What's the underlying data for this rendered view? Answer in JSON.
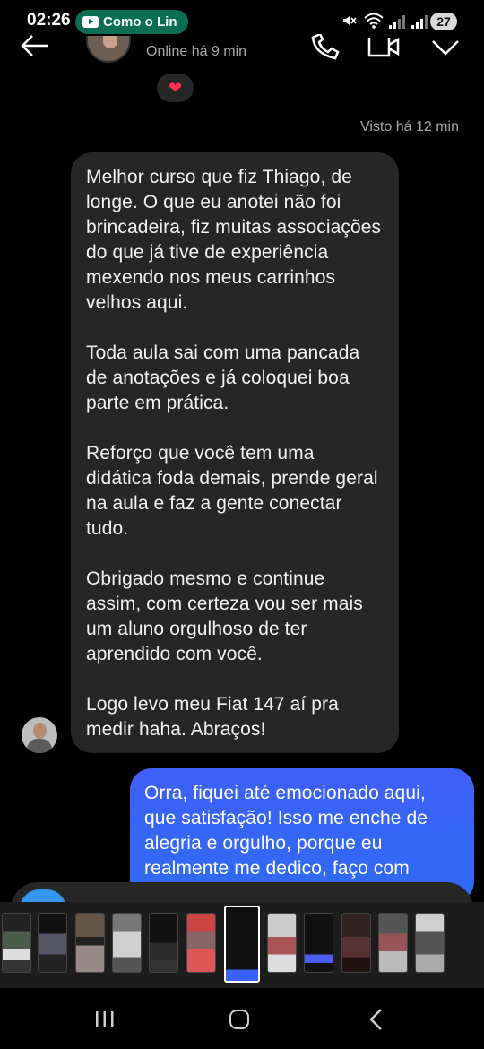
{
  "status_bar": {
    "time": "02:26",
    "notification_text": "Como o Lin",
    "battery": "27"
  },
  "header": {
    "status": "Online há 9 min"
  },
  "reaction": {
    "emoji": "❤"
  },
  "seen": "Visto há 12 min",
  "incoming_message": {
    "paragraphs": [
      "Melhor curso que fiz Thiago, de longe. O que eu anotei não foi brincadeira, fiz muitas associações do que já tive de experiência mexendo nos meus carrinhos velhos aqui.",
      "Toda aula sai com uma pancada de anotações e já coloquei boa parte em prática.",
      "Reforço que você tem uma didática foda demais, prende geral na aula e faz a gente conectar tudo.",
      "Obrigado mesmo e continue assim, com certeza vou ser mais um aluno orgulhoso de ter aprendido com você.",
      "Logo levo meu Fiat 147 aí pra medir haha. Abraços!"
    ]
  },
  "outgoing_message": {
    "text": "Orra, fiquei até emocionado aqui, que satisfação! Isso me enche de alegria e orgulho, porque eu realmente me dedico, faço com"
  },
  "thumbnails": {
    "count": 12,
    "selected_index": 6
  },
  "colors": {
    "background": "#000000",
    "incoming_bubble": "#262626",
    "outgoing_bubble": "#3a63f5",
    "muted_text": "#a8a8a8"
  }
}
